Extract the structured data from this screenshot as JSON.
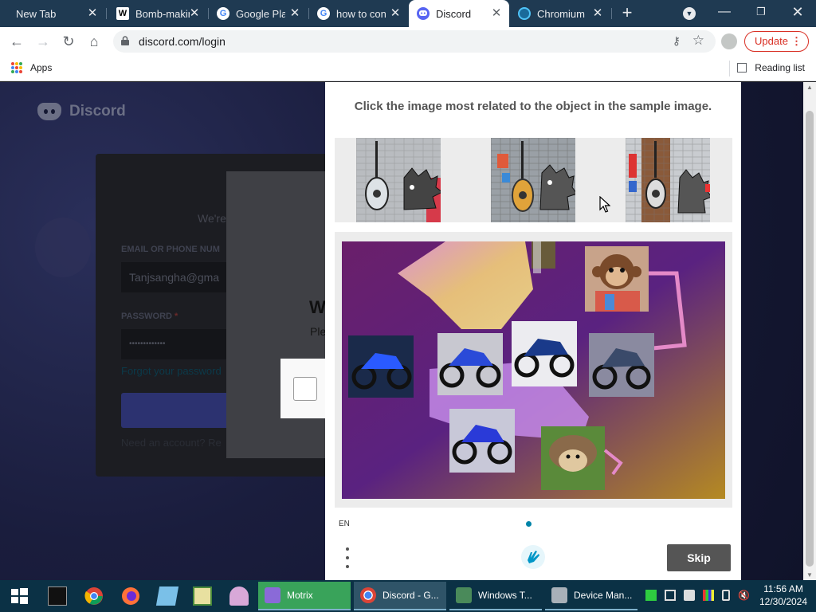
{
  "tabs": [
    {
      "title": "New Tab",
      "active": false
    },
    {
      "title": "Bomb-making",
      "favicon": "W",
      "active": false
    },
    {
      "title": "Google Play",
      "favicon": "G",
      "active": false
    },
    {
      "title": "how to con",
      "favicon": "G",
      "active": false
    },
    {
      "title": "Discord",
      "favicon": "discord",
      "active": true
    },
    {
      "title": "Chromium",
      "favicon": "C",
      "active": false
    }
  ],
  "toolbar": {
    "url": "discord.com/login",
    "update_label": "Update"
  },
  "bookmarks": {
    "apps_label": "Apps",
    "reading_list_label": "Reading list"
  },
  "discord_page": {
    "brand": "Discord",
    "welcome_partial": "We're",
    "email_label": "EMAIL OR PHONE NUM",
    "email_value": "Tanjsangha@gma",
    "password_label": "PASSWORD",
    "password_required": "*",
    "password_value": "•••••••••••••",
    "forgot_link": "Forgot your password",
    "need_account": "Need an account? Re",
    "modal_heading_partial": "W",
    "modal_text_partial": "Ple"
  },
  "captcha": {
    "instruction": "Click the image most related to the object in the sample image.",
    "language": "EN",
    "skip_label": "Skip",
    "sample_images": [
      "guitar-and-hedgehog-graffiti-1",
      "guitar-and-hedgehog-graffiti-2",
      "guitar-and-hedgehog-graffiti-3"
    ],
    "main_image_items": [
      "monkey",
      "blue-motorcycle",
      "blue-motorcycle",
      "blue-motorcycle",
      "blue-motorcycle",
      "blue-motorcycle",
      "hedgehog"
    ]
  },
  "taskbar": {
    "tasks": [
      "Motrix",
      "Discord - G...",
      "Windows T...",
      "Device Man..."
    ],
    "time": "11:56 AM",
    "date": "12/30/2024"
  },
  "colors": {
    "tab_strip": "#1f3a52",
    "discord_bg": "#141832",
    "skip_button": "#555555",
    "update_accent": "#d93025",
    "taskbar": "#0b3145"
  }
}
